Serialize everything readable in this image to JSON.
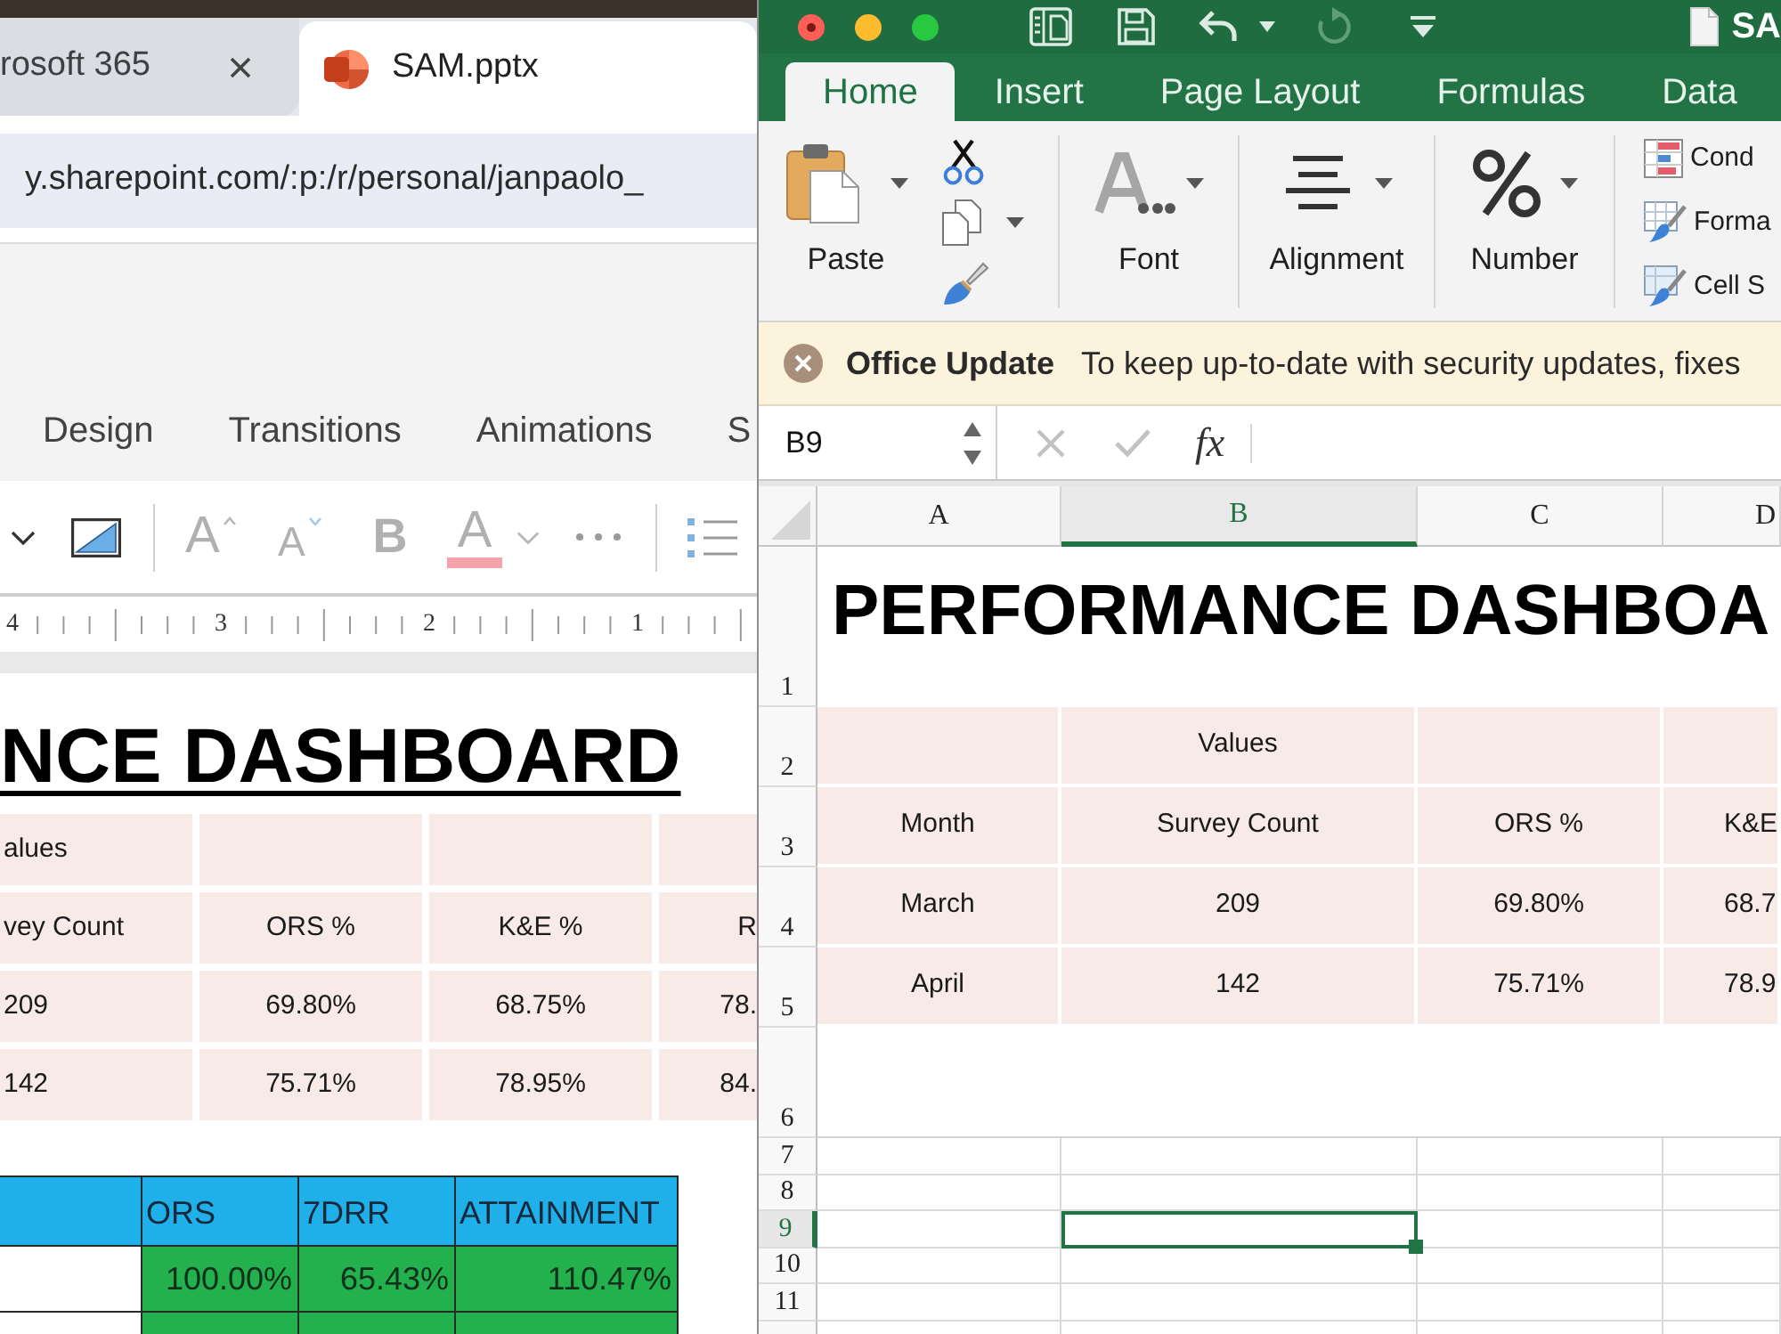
{
  "browser": {
    "tabs": [
      {
        "title": "rosoft 365",
        "selected": false
      },
      {
        "title": "SAM.pptx",
        "selected": true
      }
    ],
    "address_bar": {
      "value": "y.sharepoint.com/:p:/r/personal/janpaolo_"
    }
  },
  "powerpoint": {
    "ribbon_tabs": [
      {
        "label": "Design",
        "selected": false
      },
      {
        "label": "Transitions",
        "selected": false
      },
      {
        "label": "Animations",
        "selected": false
      },
      {
        "label": "S",
        "selected": false
      }
    ],
    "font_buttons": [
      {
        "kind": "grow",
        "glyph": "A",
        "disabled": true
      },
      {
        "kind": "shrink",
        "glyph": "A",
        "disabled": true
      },
      {
        "kind": "bold",
        "glyph": "B",
        "disabled": true
      },
      {
        "kind": "color",
        "glyph": "A",
        "disabled": true
      }
    ],
    "ruler": [
      "4",
      "3",
      "2",
      "1"
    ],
    "slide": {
      "title": "NCE DASHBOARD",
      "pivot_table": [
        {
          "column_1": "alues"
        },
        {
          "column_1": "vey Count",
          "column_2": "ORS %",
          "column_3": "K&E %",
          "column_4": "R"
        },
        {
          "column_1": "209",
          "column_2": "69.80%",
          "column_3": "68.75%",
          "column_4": "78."
        },
        {
          "column_1": "142",
          "column_2": "75.71%",
          "column_3": "78.95%",
          "column_4": "84."
        }
      ],
      "attainment_table": {
        "header": {
          "column_2": "ORS",
          "column_3": "7DRR",
          "column_4": "ATTAINMENT"
        },
        "rows": [
          {
            "column_2": "100.00%",
            "column_3": "65.43%",
            "column_4": "110.47%"
          }
        ]
      }
    }
  },
  "excel": {
    "quick_access": [
      {
        "kind": "sidebar",
        "disabled": false
      },
      {
        "kind": "save",
        "disabled": false
      },
      {
        "kind": "undo",
        "disabled": false
      },
      {
        "kind": "redo",
        "disabled": true
      },
      {
        "kind": "customize",
        "disabled": false
      }
    ],
    "title": "SA",
    "ribbon_tabs": [
      {
        "label": "Home",
        "selected": true
      },
      {
        "label": "Insert",
        "selected": false
      },
      {
        "label": "Page Layout",
        "selected": false
      },
      {
        "label": "Formulas",
        "selected": false
      },
      {
        "label": "Data",
        "selected": false
      }
    ],
    "ribbon_groups": [
      {
        "kind": "clipboard",
        "label": "Paste"
      },
      {
        "kind": "font",
        "label": "Font"
      },
      {
        "kind": "alignment",
        "label": "Alignment"
      },
      {
        "kind": "number",
        "label": "Number"
      }
    ],
    "style_commands": [
      {
        "kind": "conditional",
        "label": "Cond"
      },
      {
        "kind": "table",
        "label": "Forma"
      },
      {
        "kind": "cell",
        "label": "Cell S"
      }
    ],
    "message_bar": {
      "title": "Office Update",
      "text": "To keep up-to-date with security updates, fixes"
    },
    "formula_bar": {
      "name_box": "B9",
      "buttons": [
        {
          "kind": "cancel",
          "disabled": true
        },
        {
          "kind": "enter",
          "disabled": true
        }
      ],
      "function_glyph": "fx"
    },
    "sheet": {
      "columns": [
        {
          "label": "A",
          "selected": false
        },
        {
          "label": "B",
          "selected": true
        },
        {
          "label": "C",
          "selected": false
        },
        {
          "label": "D",
          "selected": false
        }
      ],
      "rows": [
        {
          "number": "1",
          "kind": "title",
          "selected": false,
          "cells": {
            "column_1": "PERFORMANCE DASHBOA"
          }
        },
        {
          "number": "2",
          "kind": "table",
          "selected": false,
          "cells": {
            "column_2": "Values"
          }
        },
        {
          "number": "3",
          "kind": "table",
          "selected": false,
          "cells": {
            "column_1": "Month",
            "column_2": "Survey Count",
            "column_3": "ORS %",
            "column_4": "K&E"
          }
        },
        {
          "number": "4",
          "kind": "table",
          "selected": false,
          "cells": {
            "column_1": "March",
            "column_2": "209",
            "column_3": "69.80%",
            "column_4": "68.7"
          }
        },
        {
          "number": "5",
          "kind": "table",
          "selected": false,
          "cells": {
            "column_1": "April",
            "column_2": "142",
            "column_3": "75.71%",
            "column_4": "78.9"
          }
        },
        {
          "number": "6",
          "kind": "spacer",
          "selected": false
        },
        {
          "number": "7",
          "kind": "grid",
          "selected": false
        },
        {
          "number": "8",
          "kind": "grid",
          "selected": false
        },
        {
          "number": "9",
          "kind": "grid",
          "selected": true
        },
        {
          "number": "10",
          "kind": "grid",
          "selected": false
        },
        {
          "number": "11",
          "kind": "grid",
          "selected": false
        },
        {
          "kind": "grid",
          "selected": false
        }
      ]
    }
  }
}
